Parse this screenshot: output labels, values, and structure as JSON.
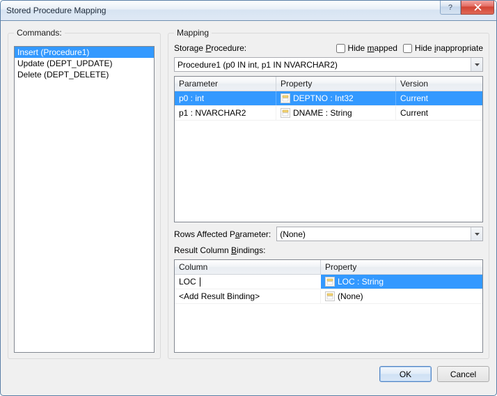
{
  "window": {
    "title": "Stored Procedure Mapping"
  },
  "commands": {
    "legend": "Commands:",
    "items": [
      {
        "label": "Insert (Procedure1)",
        "selected": true
      },
      {
        "label": "Update (DEPT_UPDATE)",
        "selected": false
      },
      {
        "label": "Delete (DEPT_DELETE)",
        "selected": false
      }
    ]
  },
  "mapping": {
    "legend": "Mapping",
    "storage_proc_label_pre": "Storage ",
    "storage_proc_label_u": "P",
    "storage_proc_label_post": "rocedure:",
    "hide_mapped_pre": "Hide ",
    "hide_mapped_u": "m",
    "hide_mapped_post": "apped",
    "hide_inapp_pre": "Hide ",
    "hide_inapp_u": "i",
    "hide_inapp_post": "nappropriate",
    "procedure_value": "Procedure1 (p0 IN int, p1 IN NVARCHAR2)",
    "params_grid": {
      "headers": {
        "parameter": "Parameter",
        "property": "Property",
        "version": "Version"
      },
      "rows": [
        {
          "parameter": "p0 : int",
          "property": "DEPTNO : Int32",
          "version": "Current",
          "selected": true
        },
        {
          "parameter": "p1 : NVARCHAR2",
          "property": "DNAME : String",
          "version": "Current",
          "selected": false
        }
      ]
    },
    "rows_affected_label_pre": "Rows Affected P",
    "rows_affected_label_u": "a",
    "rows_affected_label_post": "rameter:",
    "rows_affected_value": "(None)",
    "result_bindings_label_pre": "Result Column ",
    "result_bindings_label_u": "B",
    "result_bindings_label_post": "indings:",
    "result_grid": {
      "headers": {
        "column": "Column",
        "property": "Property"
      },
      "rows": [
        {
          "column": "LOC",
          "editing": true,
          "property": "LOC : String",
          "selected": true
        },
        {
          "column": "<Add Result Binding>",
          "editing": false,
          "property": "(None)",
          "selected": false
        }
      ]
    }
  },
  "buttons": {
    "ok": "OK",
    "cancel": "Cancel"
  }
}
